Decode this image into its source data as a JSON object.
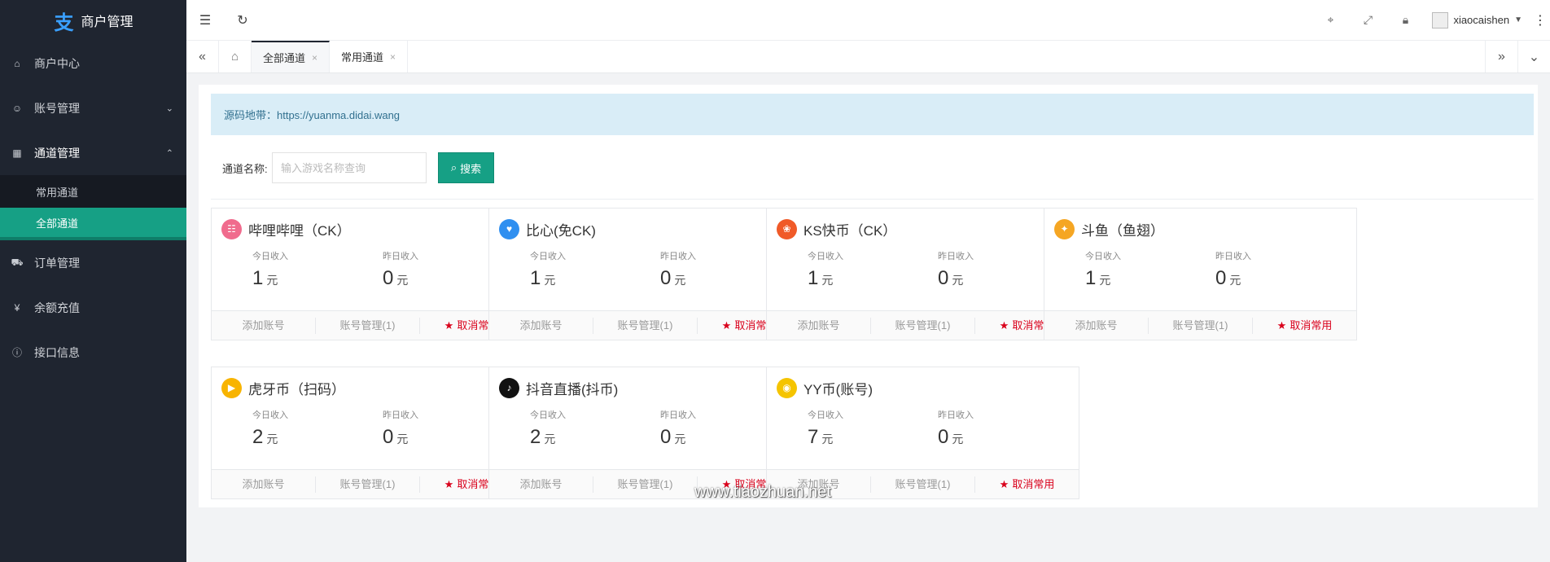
{
  "sidebar": {
    "brand": "商户管理",
    "items": [
      {
        "label": "商户中心"
      },
      {
        "label": "账号管理"
      },
      {
        "label": "通道管理"
      },
      {
        "label": "订单管理"
      },
      {
        "label": "余额充值"
      },
      {
        "label": "接口信息"
      }
    ],
    "subitems": [
      {
        "label": "常用通道"
      },
      {
        "label": "全部通道"
      }
    ]
  },
  "header": {
    "username": "xiaocaishen"
  },
  "tabs": [
    {
      "label": "全部通道"
    },
    {
      "label": "常用通道"
    }
  ],
  "notice": "源码地带：https://yuanma.didai.wang",
  "search": {
    "label": "通道名称:",
    "placeholder": "输入游戏名称查询",
    "button": "搜索"
  },
  "card_labels": {
    "today": "今日收入",
    "yesterday": "昨日收入",
    "unit": "元",
    "add": "添加账号",
    "cancel": "取消常用"
  },
  "cards": [
    {
      "title": "哔哩哔哩（CK）",
      "today": "1",
      "yesterday": "0",
      "manage": "账号管理(1)",
      "color": "#f06b8d",
      "glyph": "bili"
    },
    {
      "title": "比心(免CK)",
      "today": "1",
      "yesterday": "0",
      "manage": "账号管理(1)",
      "color": "#2f8ff0",
      "glyph": "bixin"
    },
    {
      "title": "KS快币（CK）",
      "today": "1",
      "yesterday": "0",
      "manage": "账号管理(1)",
      "color": "#f05a28",
      "glyph": "ks"
    },
    {
      "title": "斗鱼（鱼翅）",
      "today": "1",
      "yesterday": "0",
      "manage": "账号管理(1)",
      "color": "#f5a623",
      "glyph": "douyu"
    },
    {
      "title": "虎牙币（扫码）",
      "today": "2",
      "yesterday": "0",
      "manage": "账号管理(1)",
      "color": "#f8b400",
      "glyph": "huya"
    },
    {
      "title": "抖音直播(抖币)",
      "today": "2",
      "yesterday": "0",
      "manage": "账号管理(1)",
      "color": "#111111",
      "glyph": "douyin"
    },
    {
      "title": "YY币(账号)",
      "today": "7",
      "yesterday": "0",
      "manage": "账号管理(1)",
      "color": "#f5c400",
      "glyph": "yy"
    }
  ],
  "watermark": "www.tiaozhuan.net"
}
